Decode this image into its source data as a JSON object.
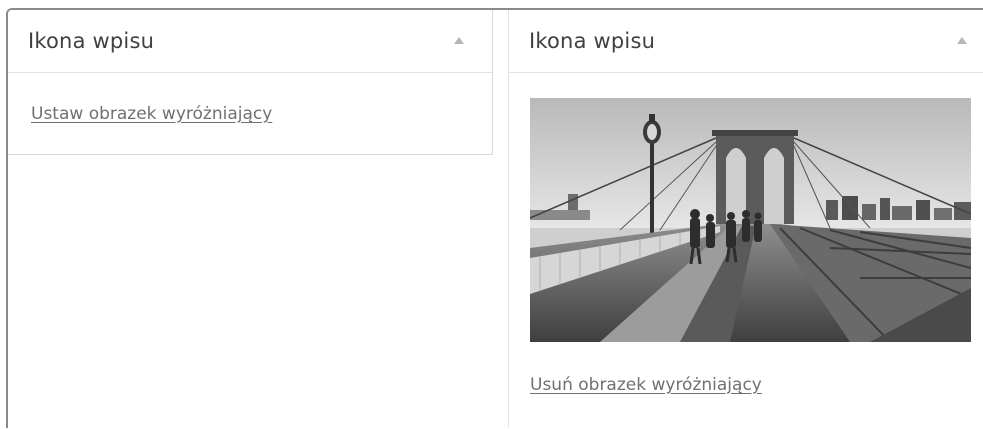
{
  "left_panel": {
    "title": "Ikona wpisu",
    "toggle_icon": "arrow-up-icon",
    "set_link": "Ustaw obrazek wyróżniający"
  },
  "right_panel": {
    "title": "Ikona wpisu",
    "toggle_icon": "arrow-up-icon",
    "image_icon": "bridge-photo",
    "remove_link": "Usuń obrazek wyróżniający"
  }
}
